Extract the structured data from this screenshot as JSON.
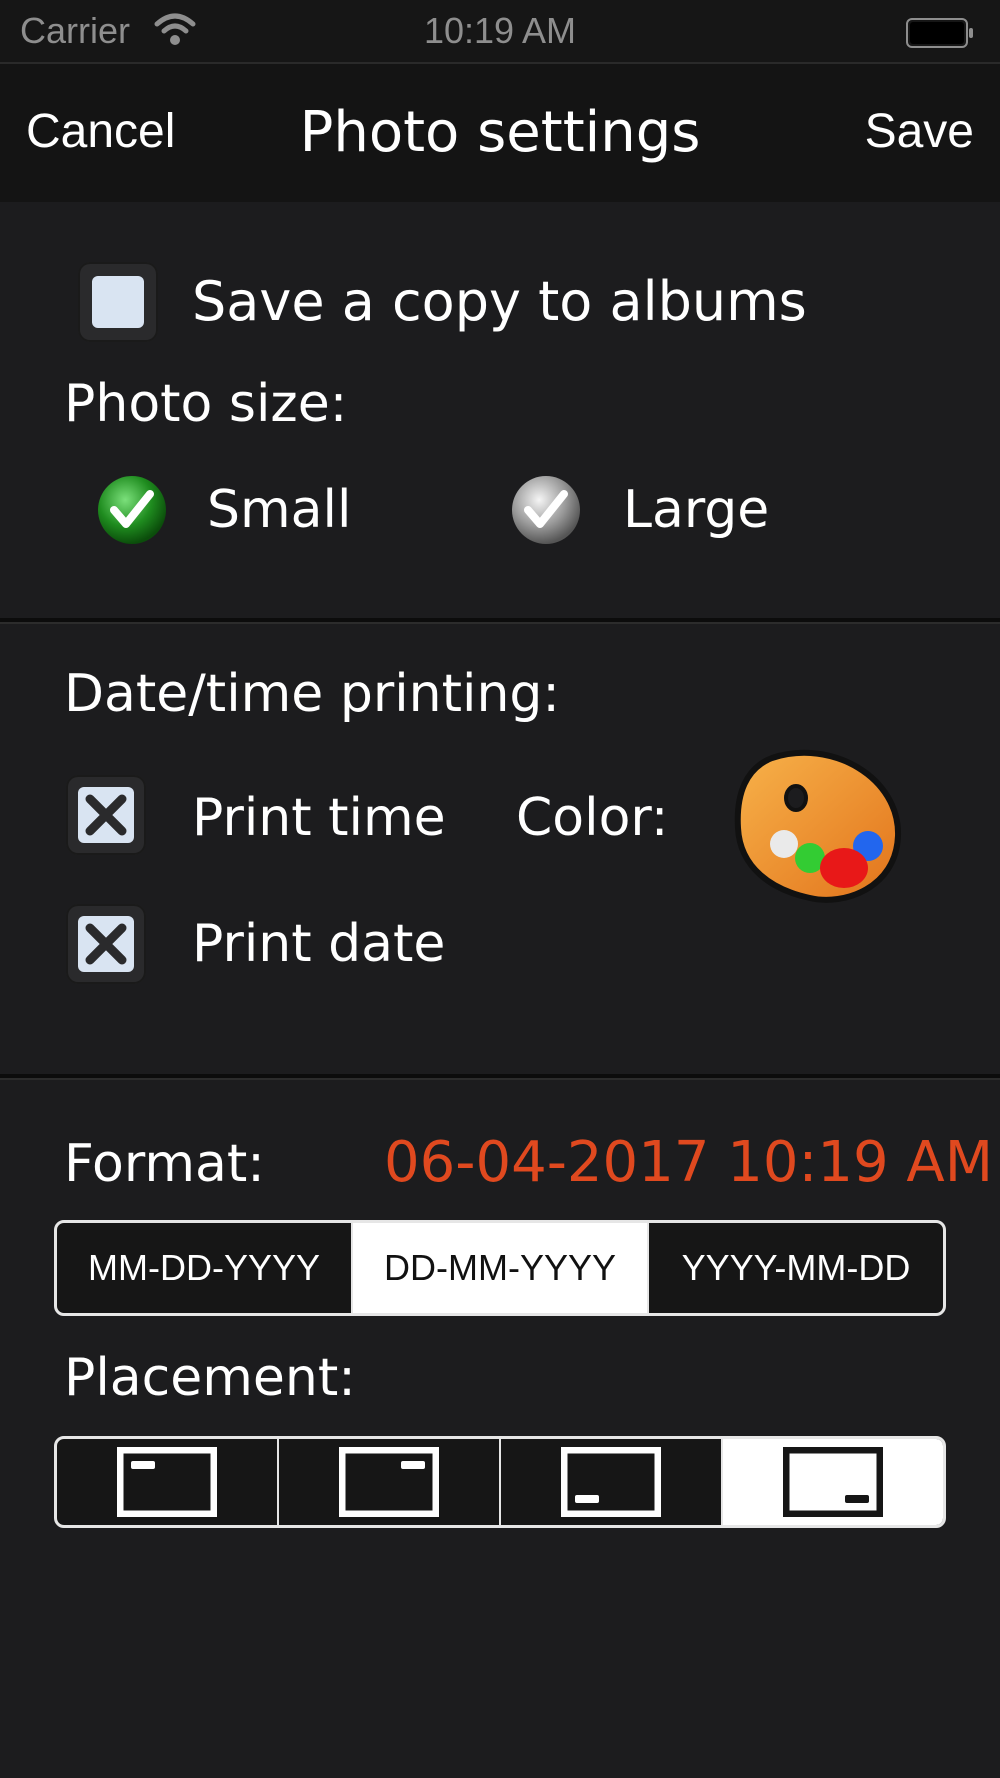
{
  "status_bar": {
    "carrier": "Carrier",
    "time": "10:19 AM",
    "wifi_icon": "wifi-icon",
    "battery_icon": "battery-icon"
  },
  "nav": {
    "cancel_label": "Cancel",
    "title": "Photo settings",
    "save_label": "Save"
  },
  "albums": {
    "label": "Save a copy to albums",
    "checked": false
  },
  "photo_size": {
    "label": "Photo size:",
    "options": [
      {
        "label": "Small",
        "selected": true
      },
      {
        "label": "Large",
        "selected": false
      }
    ]
  },
  "date_time": {
    "label": "Date/time printing:",
    "print_time_label": "Print time",
    "print_time_checked": true,
    "print_date_label": "Print date",
    "print_date_checked": true,
    "color_label": "Color:",
    "color_icon": "palette-icon"
  },
  "format": {
    "label": "Format:",
    "preview": "06-04-2017 10:19 AM",
    "preview_color": "#e0491f",
    "options": [
      "MM-DD-YYYY",
      "DD-MM-YYYY",
      "YYYY-MM-DD"
    ],
    "selected": "DD-MM-YYYY"
  },
  "placement": {
    "label": "Placement:",
    "options": [
      "top-left",
      "top-right",
      "bottom-left",
      "bottom-right"
    ],
    "selected": "bottom-right"
  }
}
